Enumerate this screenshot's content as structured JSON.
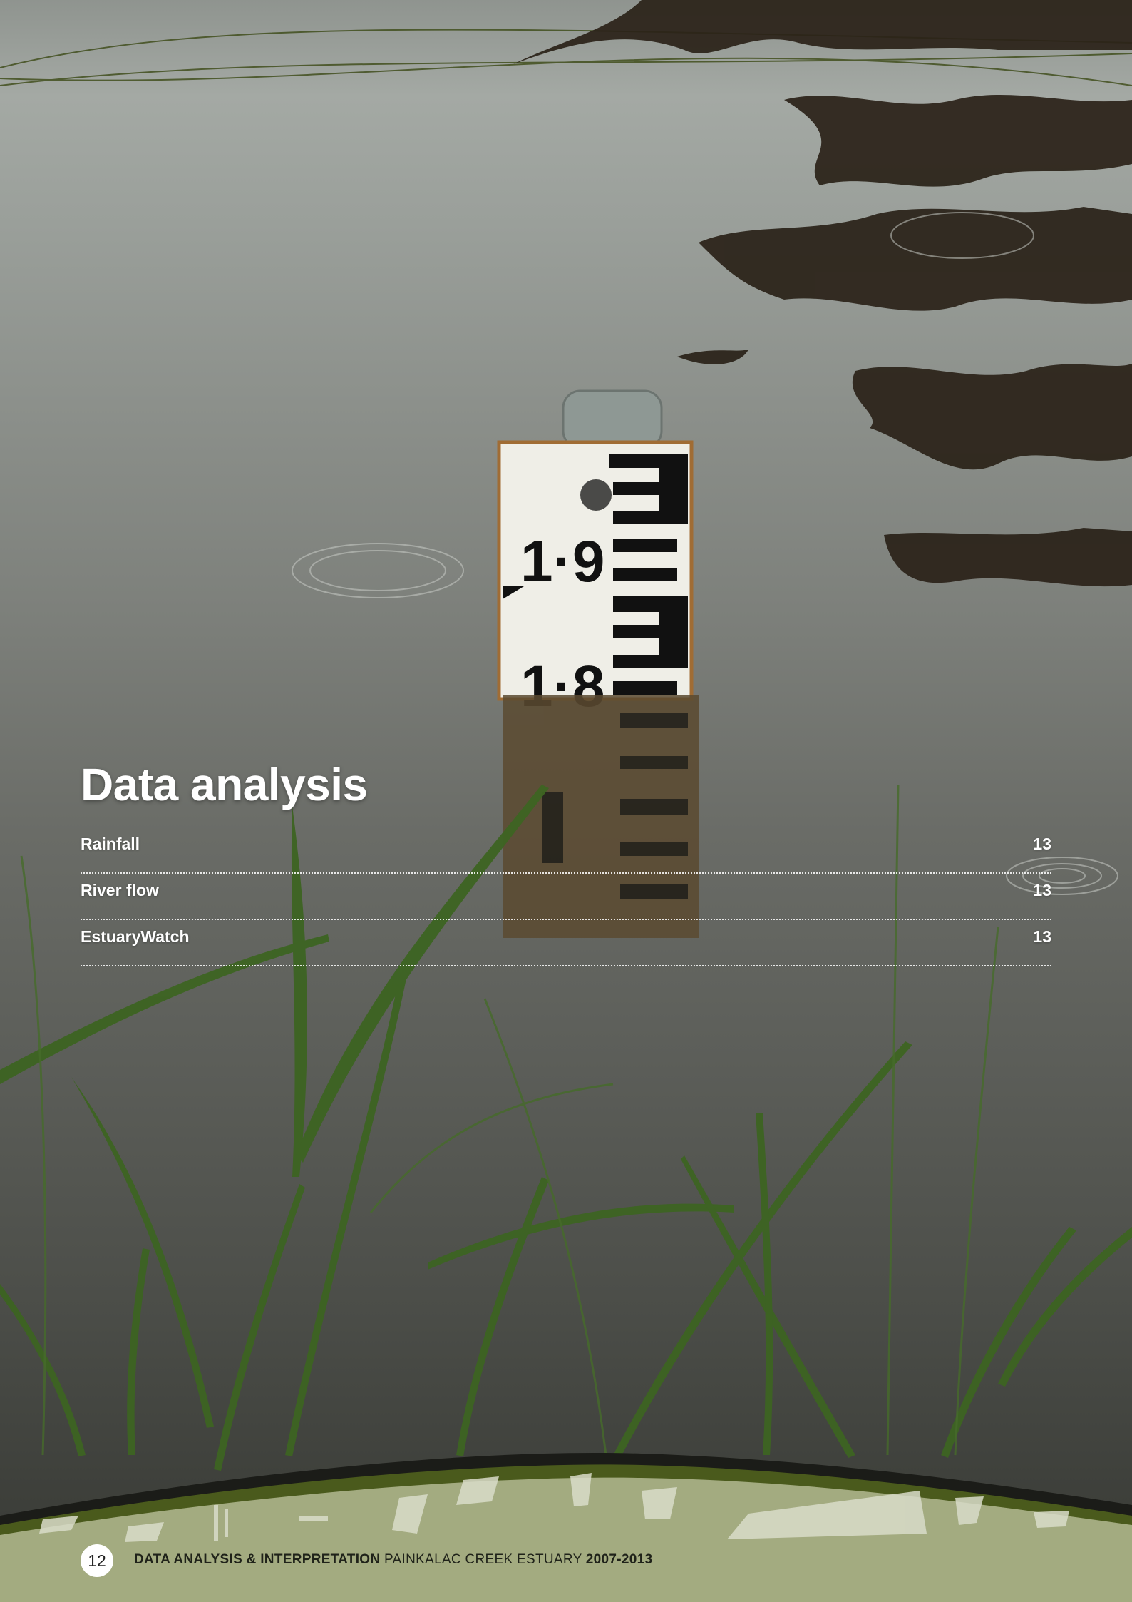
{
  "section": {
    "title": "Data analysis",
    "items": [
      {
        "label": "Rainfall",
        "page": "13"
      },
      {
        "label": "River flow",
        "page": "13"
      },
      {
        "label": "EstuaryWatch",
        "page": "13"
      }
    ]
  },
  "gauge": {
    "upper_mark": "1·9",
    "lower_mark": "1·8"
  },
  "footer": {
    "page_number": "12",
    "title_bold": "DATA ANALYSIS & INTERPRETATION",
    "title_regular": "PAINKALAC CREEK ESTUARY",
    "years": "2007-2013"
  },
  "colors": {
    "footer_band": "#a3ab80",
    "footer_stripe": "#4a5a1c",
    "footer_dark": "#1b1c18",
    "reed_green": "#3f6a22"
  }
}
